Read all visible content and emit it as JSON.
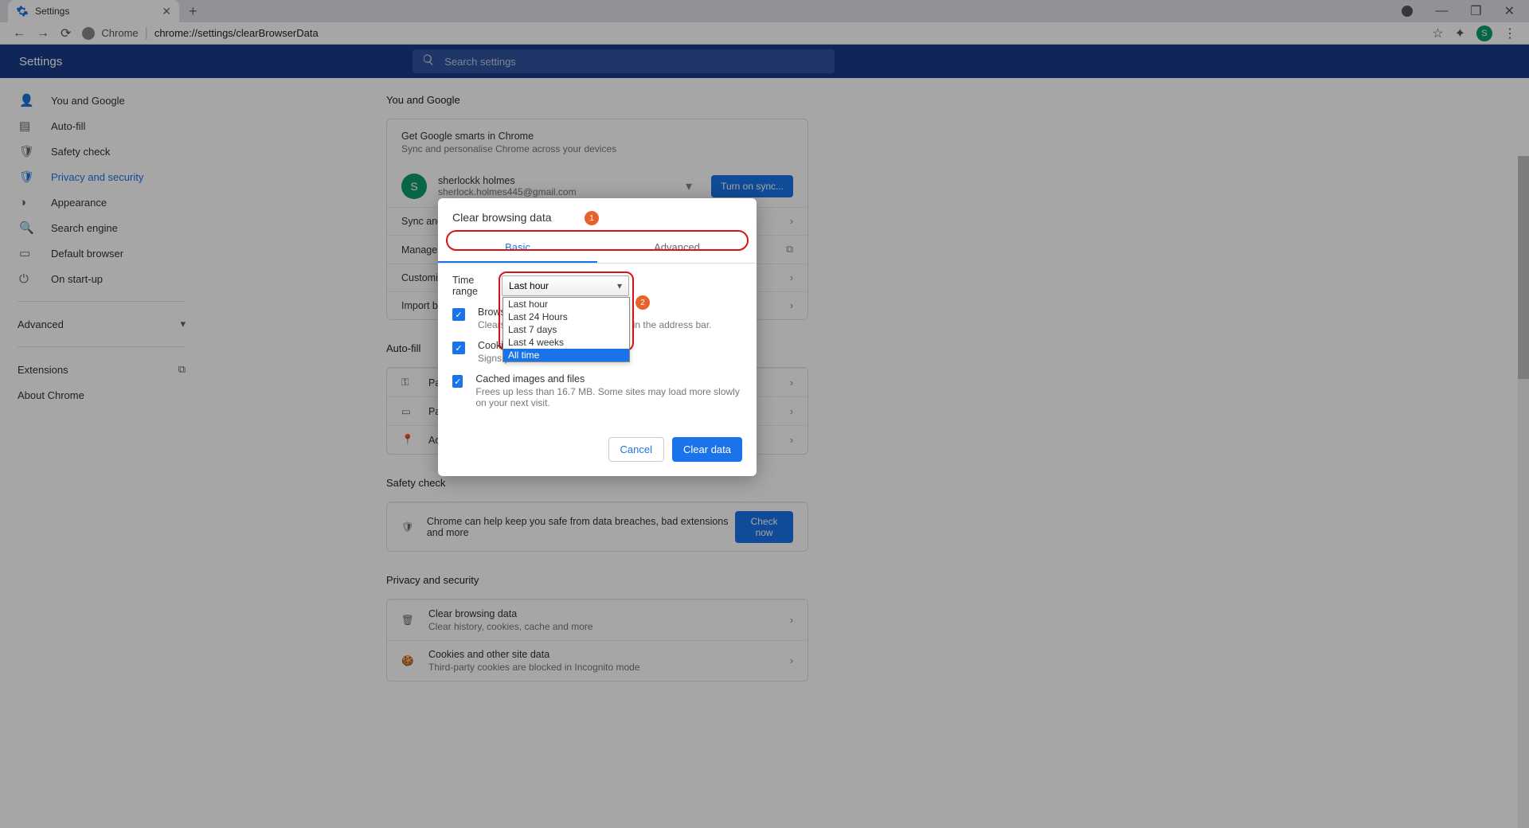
{
  "tab": {
    "title": "Settings"
  },
  "address": {
    "host": "Chrome",
    "path": "chrome://settings/clearBrowserData"
  },
  "header": {
    "title": "Settings",
    "search_placeholder": "Search settings"
  },
  "sidebar": {
    "items": [
      {
        "label": "You and Google"
      },
      {
        "label": "Auto-fill"
      },
      {
        "label": "Safety check"
      },
      {
        "label": "Privacy and security"
      },
      {
        "label": "Appearance"
      },
      {
        "label": "Search engine"
      },
      {
        "label": "Default browser"
      },
      {
        "label": "On start-up"
      }
    ],
    "advanced": "Advanced",
    "extensions": "Extensions",
    "about": "About Chrome"
  },
  "main": {
    "you_and_google": {
      "heading": "You and Google",
      "card_title": "Get Google smarts in Chrome",
      "card_sub": "Sync and personalise Chrome across your devices",
      "account_name": "sherlockk holmes",
      "account_email": "sherlock.holmes445@gmail.com",
      "sync_btn": "Turn on sync...",
      "rows": [
        "Sync and Google services",
        "Manage your Google Account",
        "Customise your Chrome profile",
        "Import bookmarks and settings"
      ]
    },
    "autofill": {
      "heading": "Auto-fill",
      "rows": [
        "Passwords",
        "Payment methods",
        "Addresses and more"
      ]
    },
    "safety": {
      "heading": "Safety check",
      "desc": "Chrome can help keep you safe from data breaches, bad extensions and more",
      "btn": "Check now"
    },
    "privacy": {
      "heading": "Privacy and security",
      "rows": [
        {
          "title": "Clear browsing data",
          "sub": "Clear history, cookies, cache and more"
        },
        {
          "title": "Cookies and other site data",
          "sub": "Third-party cookies are blocked in Incognito mode"
        }
      ]
    }
  },
  "dialog": {
    "title": "Clear browsing data",
    "tabs": {
      "basic": "Basic",
      "advanced": "Advanced"
    },
    "time_label": "Time range",
    "time_selected": "Last hour",
    "time_options": [
      "Last hour",
      "Last 24 Hours",
      "Last 7 days",
      "Last 4 weeks",
      "All time"
    ],
    "highlighted_option_index": 4,
    "checks": [
      {
        "title": "Browsing history",
        "sub": "Clears history and auto-completions in the address bar."
      },
      {
        "title": "Cookies and other site data",
        "sub": "Signs you out of most sites."
      },
      {
        "title": "Cached images and files",
        "sub": "Frees up less than 16.7 MB. Some sites may load more slowly on your next visit."
      }
    ],
    "cancel": "Cancel",
    "clear": "Clear data"
  },
  "annotations": {
    "badge1": "1",
    "badge2": "2"
  }
}
